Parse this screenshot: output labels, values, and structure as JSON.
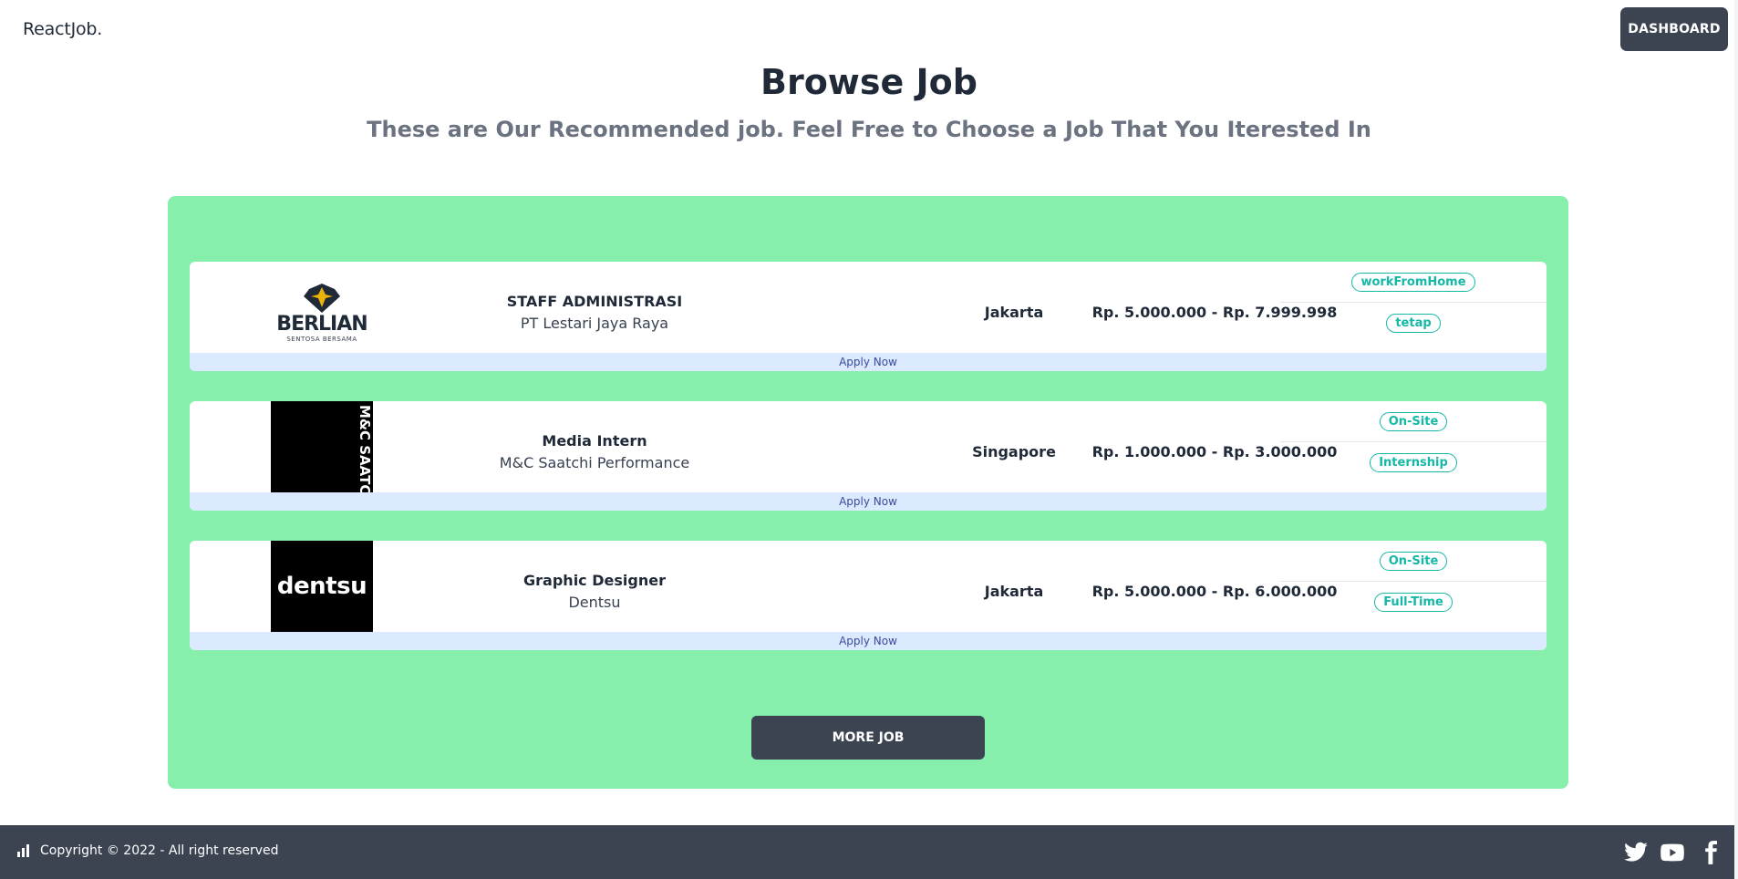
{
  "navbar": {
    "brand": "ReactJob.",
    "dashboard_label": "DASHBOARD"
  },
  "header": {
    "title": "Browse Job",
    "subtitle": "These are Our Recommended job. Feel Free to Choose a Job That You Iterested In"
  },
  "jobs": [
    {
      "logo": {
        "name": "BERLIAN",
        "sub": "SENTOSA BERSAMA"
      },
      "title": "STAFF ADMINISTRASI",
      "company": "PT Lestari Jaya Raya",
      "location": "Jakarta",
      "salary": "Rp. 5.000.000 - Rp. 7.999.998",
      "tags": [
        "workFromHome",
        "tetap"
      ],
      "apply_label": "Apply Now"
    },
    {
      "logo": {
        "name": "M&C SAATCHI PERFORMANCE"
      },
      "title": "Media Intern",
      "company": "M&C Saatchi Performance",
      "location": "Singapore",
      "salary": "Rp. 1.000.000 - Rp. 3.000.000",
      "tags": [
        "On-Site",
        "Internship"
      ],
      "apply_label": "Apply Now"
    },
    {
      "logo": {
        "name": "dentsu"
      },
      "title": "Graphic Designer",
      "company": "Dentsu",
      "location": "Jakarta",
      "salary": "Rp. 5.000.000 - Rp. 6.000.000",
      "tags": [
        "On-Site",
        "Full-Time"
      ],
      "apply_label": "Apply Now"
    }
  ],
  "more_job_label": "MORE JOB",
  "footer": {
    "copyright": "Copyright © 2022 - All right reserved",
    "social_icons": [
      "twitter-icon",
      "youtube-icon",
      "facebook-icon"
    ]
  },
  "colors": {
    "panel_bg": "#86efac",
    "button_bg": "#3d4451",
    "tag_accent": "#14b8a6",
    "apply_bar_bg": "#dbeafe"
  }
}
